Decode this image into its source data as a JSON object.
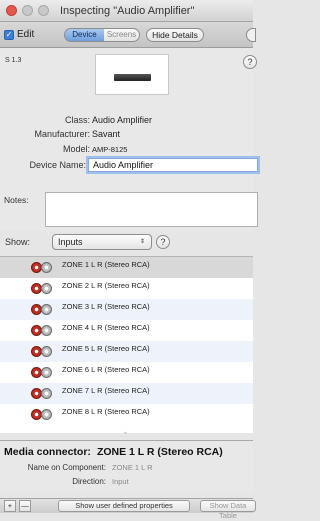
{
  "window": {
    "title": "Inspecting \"Audio Amplifier\""
  },
  "toolbar": {
    "edit_label": "Edit",
    "edit_checked": true,
    "segments": [
      "Device",
      "Screens"
    ],
    "hide_details_label": "Hide Details"
  },
  "info": {
    "version": "S 1.3",
    "help_label": "?",
    "class_label": "Class:",
    "class_value": "Audio Amplifier",
    "manufacturer_label": "Manufacturer:",
    "manufacturer_value": "Savant",
    "model_label": "Model:",
    "model_value": "AMP-8125",
    "device_name_label": "Device Name:",
    "device_name_value": "Audio Amplifier",
    "notes_label": "Notes:",
    "notes_value": ""
  },
  "show": {
    "label": "Show:",
    "selected": "Inputs",
    "arrows": "⇕",
    "help_label": "?"
  },
  "inputs": [
    {
      "label": "ZONE 1 L R (Stereo RCA)"
    },
    {
      "label": "ZONE 2 L R (Stereo RCA)"
    },
    {
      "label": "ZONE 3 L R (Stereo RCA)"
    },
    {
      "label": "ZONE 4 L R (Stereo RCA)"
    },
    {
      "label": "ZONE 5 L R (Stereo RCA)"
    },
    {
      "label": "ZONE 6 L R (Stereo RCA)"
    },
    {
      "label": "ZONE 7 L R (Stereo RCA)"
    },
    {
      "label": "ZONE 8 L R (Stereo RCA)"
    }
  ],
  "media": {
    "title_label": "Media connector:",
    "title_value": "ZONE 1 L R (Stereo RCA)",
    "component_label": "Name on Component:",
    "component_value": "ZONE 1 L R",
    "direction_label": "Direction:",
    "direction_value": "Input"
  },
  "bottombar": {
    "plus": "+",
    "minus": "—",
    "user_defined_label": "Show user defined properties",
    "data_table_label": "Show Data Table"
  },
  "colors": {
    "selection": "#d8d8d8",
    "accent": "#3c7fd9",
    "rca_red": "#c8352a"
  }
}
